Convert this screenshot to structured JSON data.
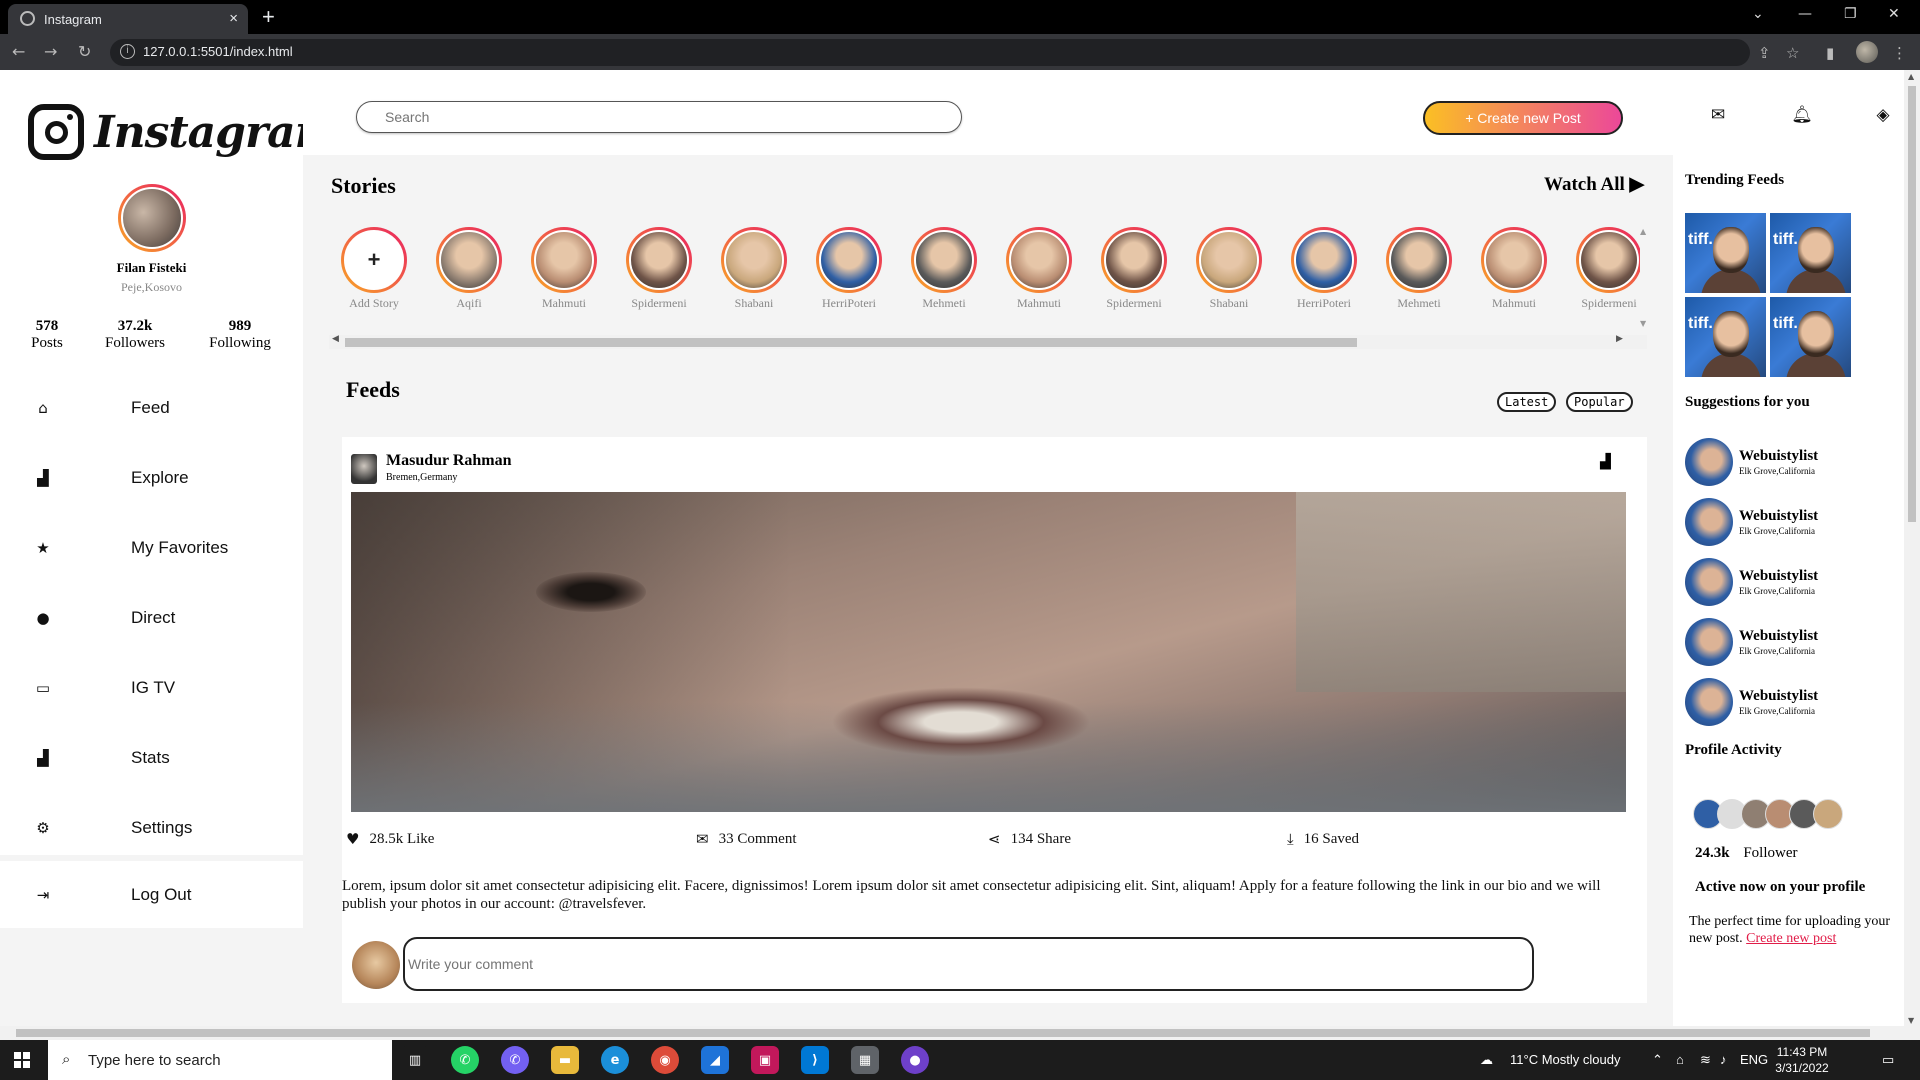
{
  "browser": {
    "tab_title": "Instagram",
    "tab_close": "×",
    "new_tab": "+",
    "url": "127.0.0.1:5501/index.html",
    "window_controls": [
      "⌄",
      "—",
      "❐",
      "✕"
    ]
  },
  "sidebar": {
    "logo_text": "Instagram",
    "profile": {
      "name": "Filan Fisteki",
      "location": "Peje,Kosovo"
    },
    "stats": [
      {
        "value": "578",
        "label": "Posts"
      },
      {
        "value": "37.2k",
        "label": "Followers"
      },
      {
        "value": "989",
        "label": "Following"
      }
    ],
    "nav": [
      {
        "label": "Feed",
        "icon": "home-icon"
      },
      {
        "label": "Explore",
        "icon": "bar-chart-icon"
      },
      {
        "label": "My Favorites",
        "icon": "star-icon"
      },
      {
        "label": "Direct",
        "icon": "chat-bubble-icon"
      },
      {
        "label": "IG TV",
        "icon": "tv-icon"
      },
      {
        "label": "Stats",
        "icon": "bar-chart-icon"
      },
      {
        "label": "Settings",
        "icon": "gear-icon"
      }
    ],
    "logout": "Log Out"
  },
  "header": {
    "search_placeholder": "Search",
    "create_button": "+ Create new Post"
  },
  "stories": {
    "title": "Stories",
    "watch_all": "Watch All",
    "items": [
      {
        "name": "Add Story",
        "add": true
      },
      {
        "name": "Aqifi",
        "color": "#8f7f72"
      },
      {
        "name": "Mahmuti",
        "color": "#b98d72"
      },
      {
        "name": "Spidermeni",
        "color": "#6f5448"
      },
      {
        "name": "Shabani",
        "color": "#c9a77c"
      },
      {
        "name": "HerriPoteri",
        "color": "#2f5fa5"
      },
      {
        "name": "Mehmeti",
        "color": "#5a5a5a"
      },
      {
        "name": "Mahmuti",
        "color": "#b98d72"
      },
      {
        "name": "Spidermeni",
        "color": "#6f5448"
      },
      {
        "name": "Shabani",
        "color": "#c9a77c"
      },
      {
        "name": "HerriPoteri",
        "color": "#2f5fa5"
      },
      {
        "name": "Mehmeti",
        "color": "#5a5a5a"
      },
      {
        "name": "Mahmuti",
        "color": "#b98d72"
      },
      {
        "name": "Spidermeni",
        "color": "#6f5448"
      }
    ]
  },
  "feeds": {
    "title": "Feeds",
    "filters": [
      "Latest",
      "Popular"
    ],
    "post": {
      "author": "Masudur Rahman",
      "location": "Bremen,Germany",
      "actions": [
        {
          "icon": "heart-icon",
          "label": "28.5k Like"
        },
        {
          "icon": "envelope-icon",
          "label": "33 Comment"
        },
        {
          "icon": "share-icon",
          "label": "134 Share"
        },
        {
          "icon": "download-icon",
          "label": "16 Saved"
        }
      ],
      "text": "Lorem, ipsum dolor sit amet consectetur adipisicing elit. Facere, dignissimos! Lorem ipsum dolor sit amet consectetur adipisicing elit. Sint, aliquam! Apply for a feature following the link in our bio and we will publish your photos in our account: @travelsfever.",
      "comment_placeholder": "Write your comment"
    }
  },
  "right_panel": {
    "trending_title": "Trending Feeds",
    "trending_label": "tiff.",
    "suggestions_title": "Suggestions for you",
    "suggestions": [
      {
        "name": "Webuistylist",
        "location": "Elk Grove,California"
      },
      {
        "name": "Webuistylist",
        "location": "Elk Grove,California"
      },
      {
        "name": "Webuistylist",
        "location": "Elk Grove,California"
      },
      {
        "name": "Webuistylist",
        "location": "Elk Grove,California"
      },
      {
        "name": "Webuistylist",
        "location": "Elk Grove,California"
      }
    ],
    "activity_title": "Profile Activity",
    "follower_count": "24.3k",
    "follower_label": "Follower",
    "active_now": "Active now on your profile",
    "perfect_text": "The perfect time for uploading your new post.",
    "create_link": "Create new post"
  },
  "taskbar": {
    "search_placeholder": "Type here to search",
    "weather": "11°C  Mostly cloudy",
    "lang": "ENG",
    "time": "11:43 PM",
    "date": "3/31/2022"
  }
}
